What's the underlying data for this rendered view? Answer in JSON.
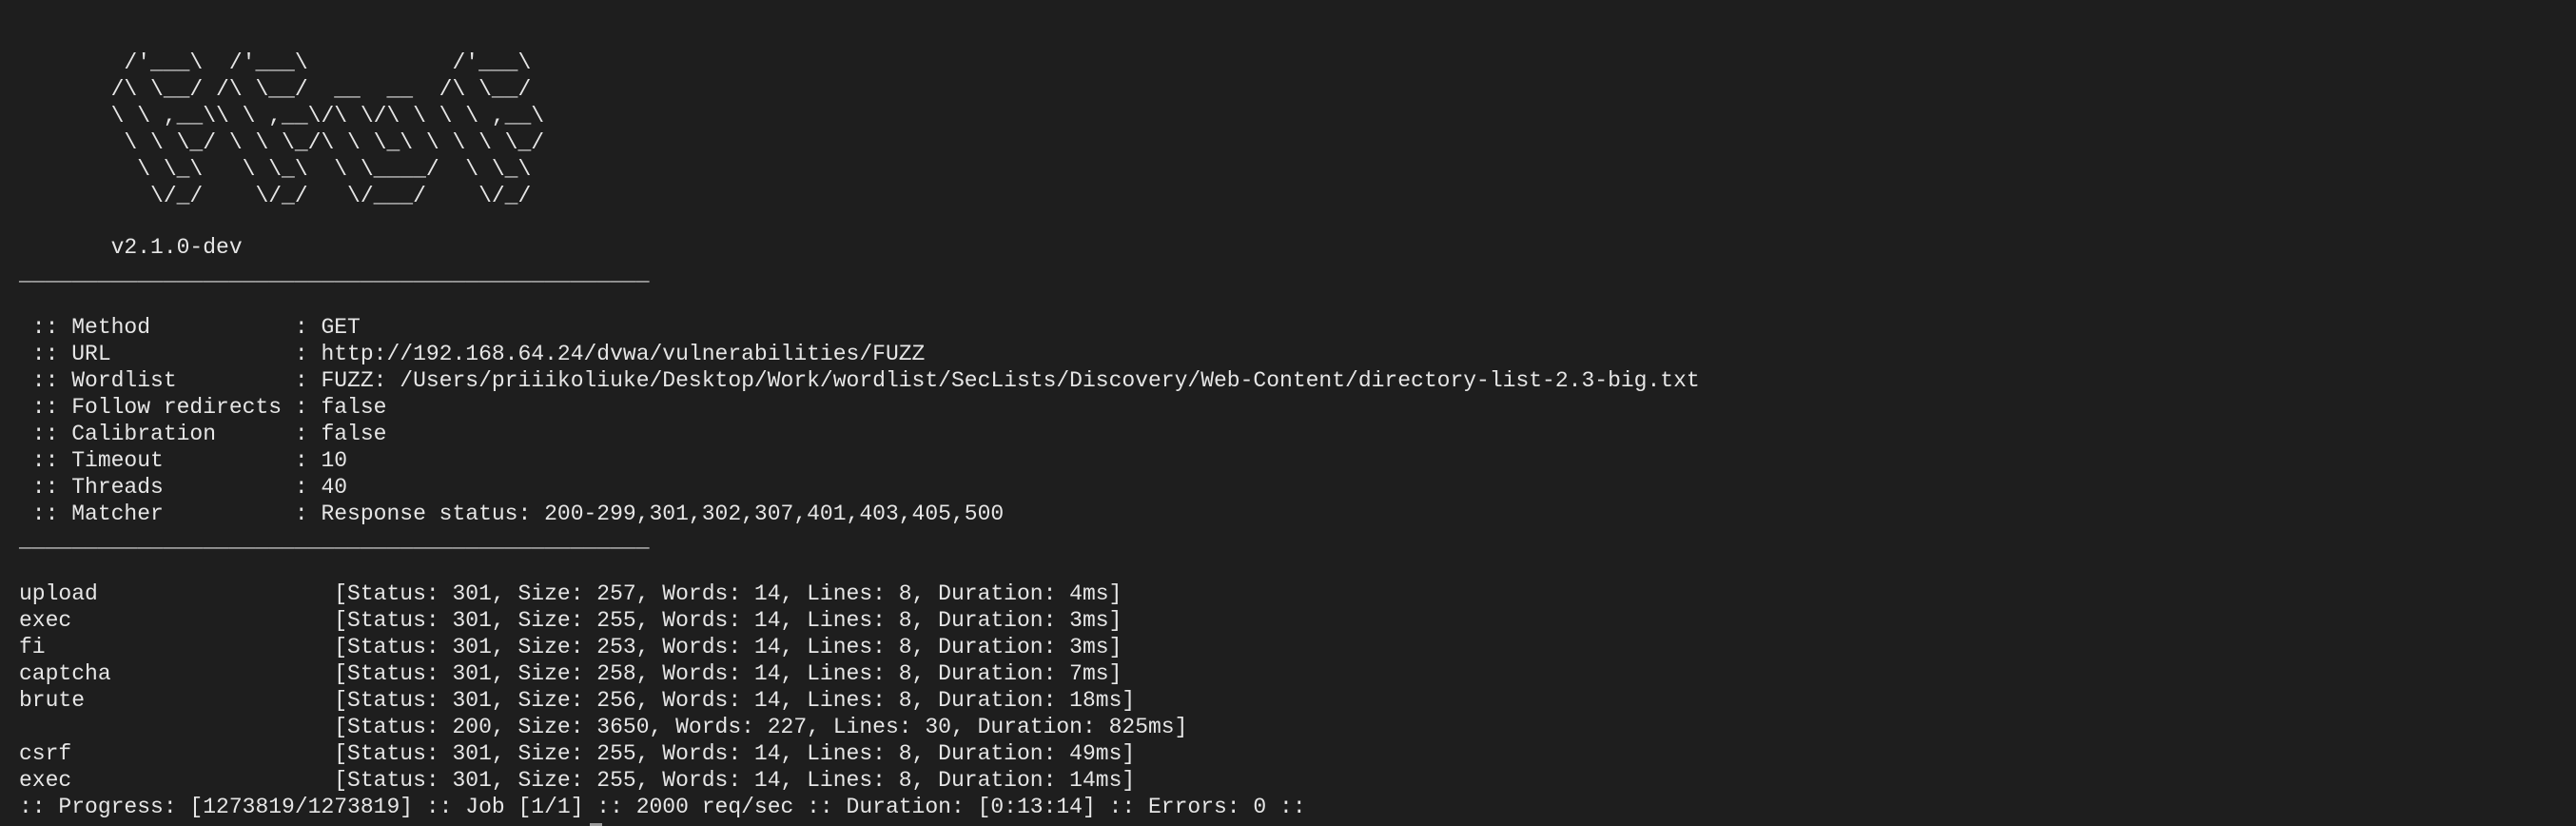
{
  "banner": {
    "lines": [
      "        /'___\\  /'___\\           /'___\\",
      "       /\\ \\__/ /\\ \\__/  __  __  /\\ \\__/",
      "       \\ \\ ,__\\\\ \\ ,__\\/\\ \\/\\ \\ \\ \\ ,__\\",
      "        \\ \\ \\_/ \\ \\ \\_/\\ \\ \\_\\ \\ \\ \\ \\_/",
      "         \\ \\_\\   \\ \\_\\  \\ \\____/  \\ \\_\\",
      "          \\/_/    \\/_/   \\/___/    \\/_/"
    ],
    "version": "       v2.1.0-dev"
  },
  "separator": "________________________________________________",
  "config": [
    " :: Method           : GET",
    " :: URL              : http://192.168.64.24/dvwa/vulnerabilities/FUZZ",
    " :: Wordlist         : FUZZ: /Users/priiikoliuke/Desktop/Work/wordlist/SecLists/Discovery/Web-Content/directory-list-2.3-big.txt",
    " :: Follow redirects : false",
    " :: Calibration      : false",
    " :: Timeout          : 10",
    " :: Threads          : 40",
    " :: Matcher          : Response status: 200-299,301,302,307,401,403,405,500"
  ],
  "results": [
    "upload                  [Status: 301, Size: 257, Words: 14, Lines: 8, Duration: 4ms]",
    "exec                    [Status: 301, Size: 255, Words: 14, Lines: 8, Duration: 3ms]",
    "fi                      [Status: 301, Size: 253, Words: 14, Lines: 8, Duration: 3ms]",
    "captcha                 [Status: 301, Size: 258, Words: 14, Lines: 8, Duration: 7ms]",
    "brute                   [Status: 301, Size: 256, Words: 14, Lines: 8, Duration: 18ms]",
    "                        [Status: 200, Size: 3650, Words: 227, Lines: 30, Duration: 825ms]",
    "csrf                    [Status: 301, Size: 255, Words: 14, Lines: 8, Duration: 49ms]",
    "exec                    [Status: 301, Size: 255, Words: 14, Lines: 8, Duration: 14ms]"
  ],
  "progress": ":: Progress: [1273819/1273819] :: Job [1/1] :: 2000 req/sec :: Duration: [0:13:14] :: Errors: 0 ::"
}
